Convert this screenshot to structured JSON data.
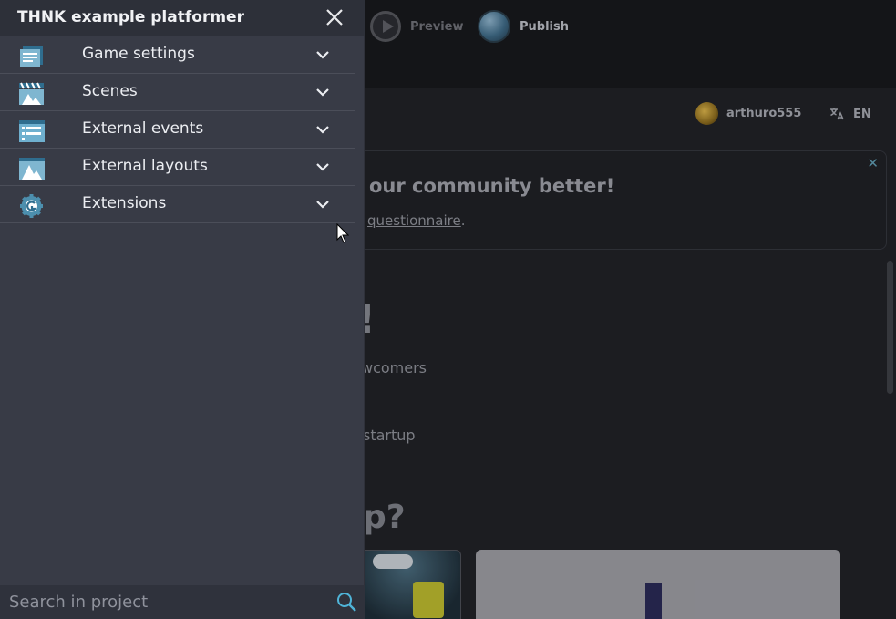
{
  "topbar": {
    "preview_label": "Preview",
    "publish_label": "Publish"
  },
  "home": {
    "username": "arthuro555",
    "language": "EN",
    "banner_title": "our community better!",
    "banner_link": "questionnaire",
    "banner_link_suffix": ".",
    "hero_bang": "!",
    "hero_newcomers": "wcomers",
    "hero_startup": "startup",
    "hero_question": "p?"
  },
  "drawer": {
    "title": "THNK example platformer",
    "items": [
      {
        "label": "Game settings",
        "icon": "game-settings-icon"
      },
      {
        "label": "Scenes",
        "icon": "scenes-icon"
      },
      {
        "label": "External events",
        "icon": "external-events-icon"
      },
      {
        "label": "External layouts",
        "icon": "external-layouts-icon"
      },
      {
        "label": "Extensions",
        "icon": "extensions-icon"
      }
    ],
    "search_placeholder": "Search in project"
  },
  "colors": {
    "drawer_bg": "#383b46",
    "header_bg": "#2d3039",
    "icon_teal": "#4c8fae",
    "search_accent": "#4fb4d8"
  }
}
